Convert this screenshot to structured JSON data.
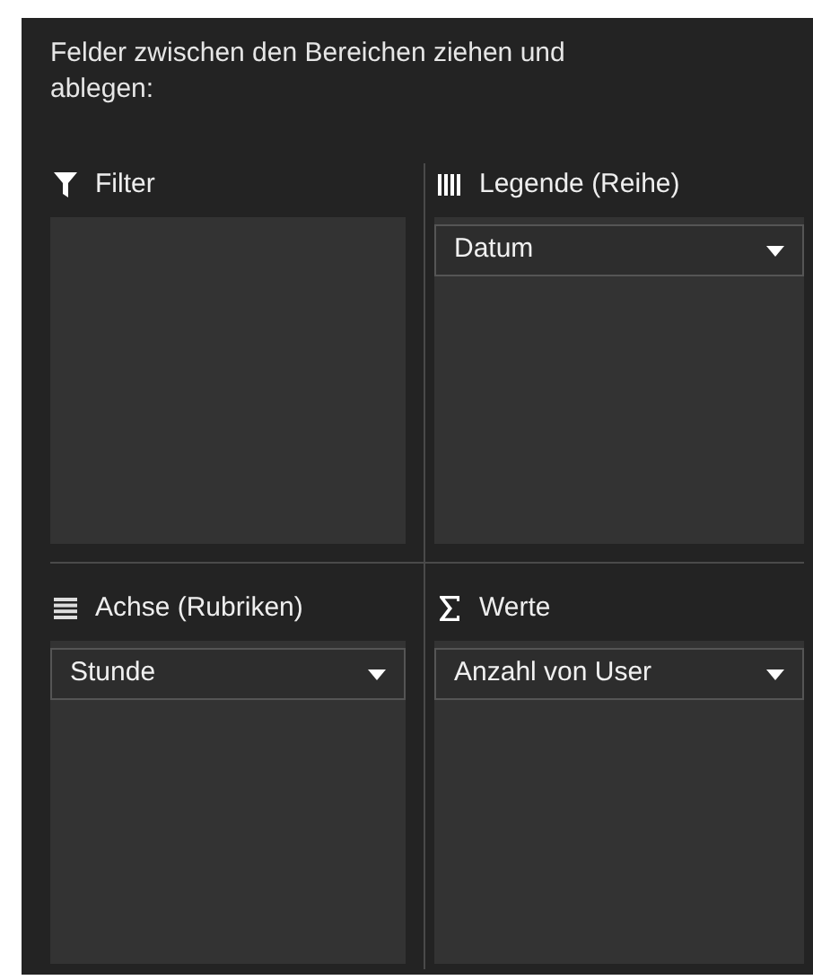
{
  "instruction": "Felder zwischen den Bereichen ziehen und ablegen:",
  "areas": [
    {
      "kind": "filter",
      "label": "Filter"
    },
    {
      "kind": "legend",
      "label": "Legende (Reihe)",
      "fields": [
        "Datum"
      ]
    },
    {
      "kind": "axis",
      "label": "Achse (Rubriken)",
      "fields": [
        "Stunde"
      ]
    },
    {
      "kind": "values",
      "label": "Werte",
      "fields": [
        "Anzahl von User"
      ]
    }
  ]
}
